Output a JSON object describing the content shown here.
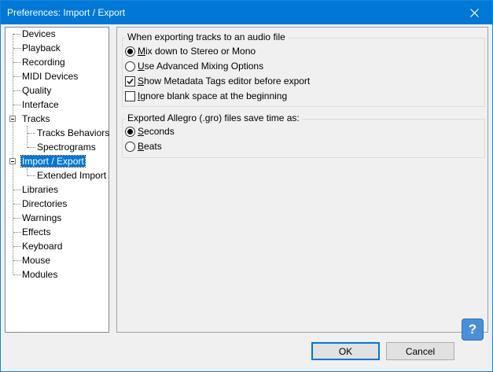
{
  "window": {
    "title": "Preferences: Import / Export"
  },
  "tree": {
    "items": [
      {
        "label": "Devices"
      },
      {
        "label": "Playback"
      },
      {
        "label": "Recording"
      },
      {
        "label": "MIDI Devices"
      },
      {
        "label": "Quality"
      },
      {
        "label": "Interface"
      },
      {
        "label": "Tracks",
        "expanded": true
      },
      {
        "label": "Tracks Behaviors"
      },
      {
        "label": "Spectrograms"
      },
      {
        "label": "Import / Export",
        "expanded": true,
        "selected": true
      },
      {
        "label": "Extended Import"
      },
      {
        "label": "Libraries"
      },
      {
        "label": "Directories"
      },
      {
        "label": "Warnings"
      },
      {
        "label": "Effects"
      },
      {
        "label": "Keyboard"
      },
      {
        "label": "Mouse"
      },
      {
        "label": "Modules"
      }
    ]
  },
  "export_group": {
    "title": "When exporting tracks to an audio file",
    "mix_stereo": {
      "first": "M",
      "rest": "ix down to Stereo or Mono",
      "checked": true
    },
    "advanced_mixing": {
      "first": "U",
      "rest": "se Advanced Mixing Options",
      "checked": false
    },
    "show_metadata": {
      "first": "S",
      "rest": "how Metadata Tags editor before export",
      "checked": true
    },
    "ignore_blank": {
      "first": "I",
      "rest": "gnore blank space at the beginning",
      "checked": false
    }
  },
  "allegro_group": {
    "title": "Exported Allegro (.gro) files save time as:",
    "seconds": {
      "first": "S",
      "rest": "econds",
      "checked": true
    },
    "beats": {
      "first": "B",
      "rest": "eats",
      "checked": false
    }
  },
  "buttons": {
    "ok": "OK",
    "cancel": "Cancel",
    "help": "?"
  },
  "colors": {
    "titlebar": "#0078d7",
    "selection": "#0078d7",
    "default_button_border": "#0078d7"
  },
  "icons": {
    "close": "close-icon",
    "help": "help-icon",
    "collapse": "collapse-icon"
  }
}
